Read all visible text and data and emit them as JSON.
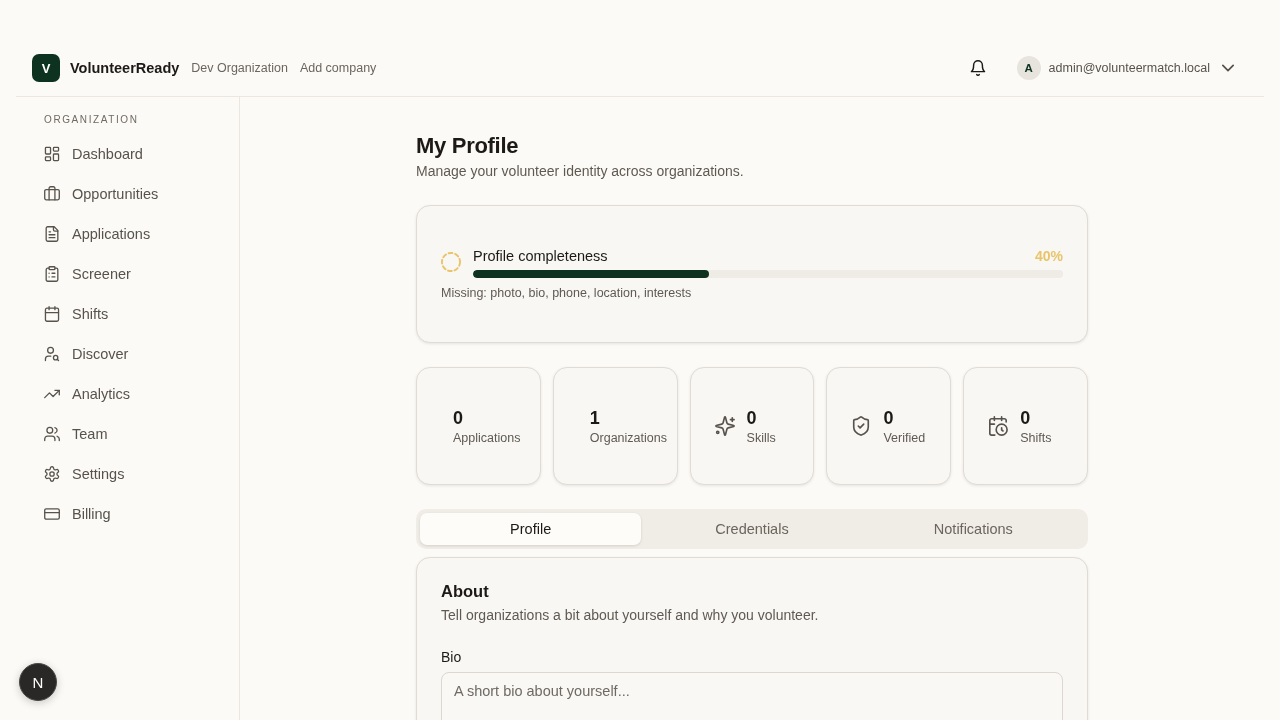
{
  "header": {
    "logo_letter": "V",
    "brand": "VolunteerReady",
    "organization": "Dev Organization",
    "add_company": "Add company",
    "user": {
      "avatar_letter": "A",
      "email": "admin@volunteermatch.local"
    }
  },
  "sidebar": {
    "section_label": "ORGANIZATION",
    "items": [
      {
        "label": "Dashboard",
        "kind": "dashboard",
        "selected": false
      },
      {
        "label": "Opportunities",
        "kind": "opportunities",
        "selected": false
      },
      {
        "label": "Applications",
        "kind": "applications",
        "selected": false
      },
      {
        "label": "Screener",
        "kind": "screener",
        "selected": false
      },
      {
        "label": "Shifts",
        "kind": "shifts",
        "selected": false
      },
      {
        "label": "Discover",
        "kind": "discover",
        "selected": false
      },
      {
        "label": "Analytics",
        "kind": "analytics",
        "selected": false
      },
      {
        "label": "Team",
        "kind": "team",
        "selected": false
      },
      {
        "label": "Settings",
        "kind": "settings",
        "selected": false
      },
      {
        "label": "Billing",
        "kind": "billing",
        "selected": false
      }
    ]
  },
  "page": {
    "title": "My Profile",
    "subtitle": "Manage your volunteer identity across organizations."
  },
  "completeness": {
    "label": "Profile completeness",
    "percent": "40%",
    "level": 0.4,
    "missing": "Missing: photo, bio, phone, location, interests"
  },
  "stats": [
    {
      "kind": "applications",
      "value": "0",
      "label": "Applications"
    },
    {
      "kind": "organizations",
      "value": "1",
      "label": "Organizations"
    },
    {
      "kind": "skills",
      "value": "0",
      "label": "Skills"
    },
    {
      "kind": "verified",
      "value": "0",
      "label": "Verified"
    },
    {
      "kind": "shifts",
      "value": "0",
      "label": "Shifts"
    }
  ],
  "tabs": [
    {
      "label": "Profile",
      "selected": true
    },
    {
      "label": "Credentials",
      "selected": false
    },
    {
      "label": "Notifications",
      "selected": false
    }
  ],
  "about": {
    "title": "About",
    "description": "Tell organizations a bit about yourself and why you volunteer.",
    "bio": {
      "label": "Bio",
      "placeholder": "A short bio about yourself..."
    }
  },
  "dev_indicator": {
    "letter": "N"
  }
}
